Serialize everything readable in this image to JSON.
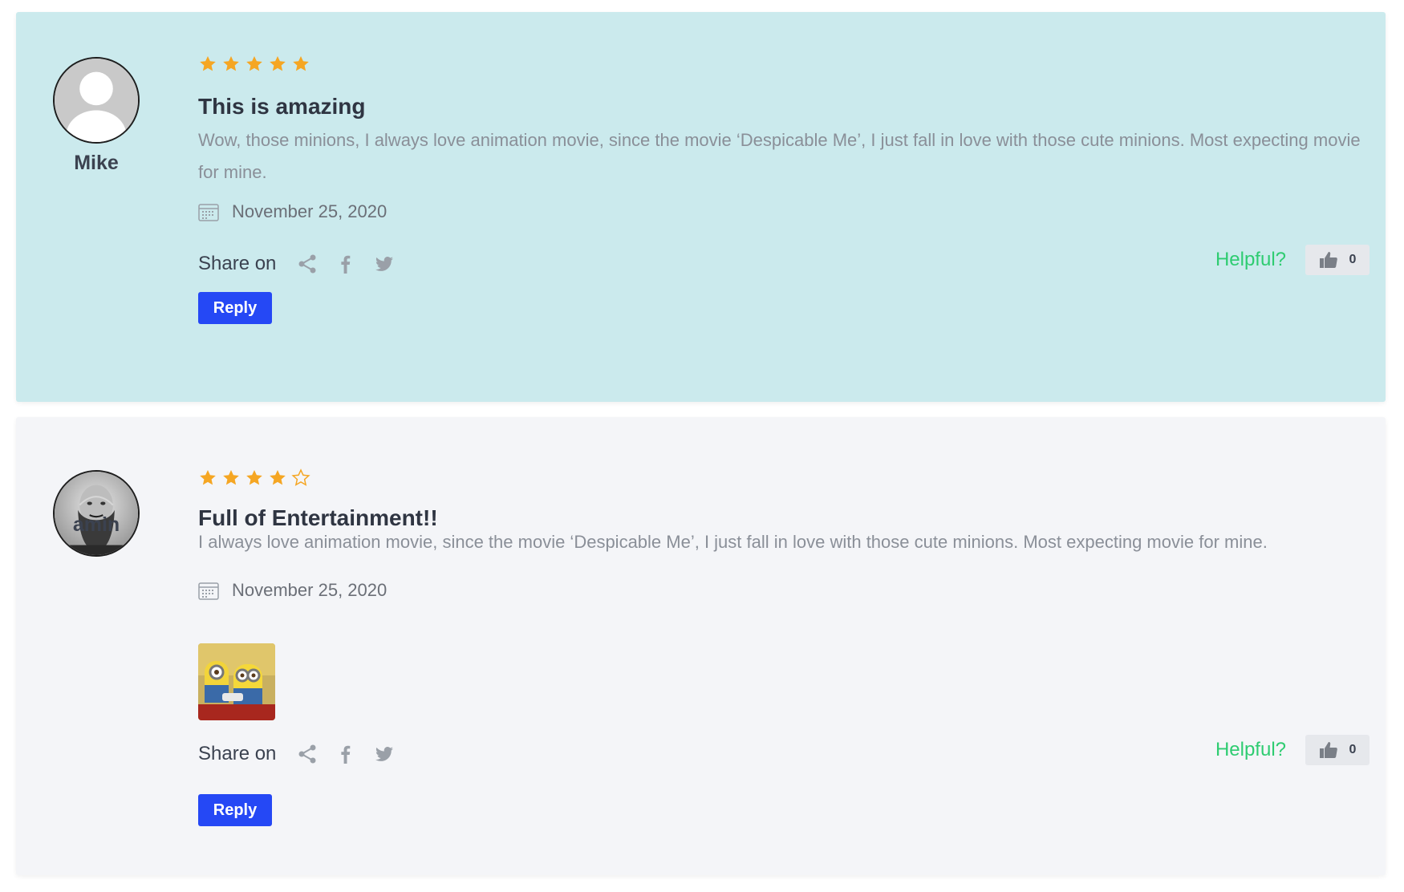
{
  "reviews": [
    {
      "author": "Mike",
      "avatar": "default-user-avatar",
      "rating": 5,
      "max_rating": 5,
      "title": "This is amazing",
      "text": "Wow, those minions, I always love animation movie, since the movie ‘Despicable Me’, I just fall in love with those cute minions. Most expecting movie for mine.",
      "date": "November 25, 2020",
      "share_label": "Share on",
      "helpful_label": "Helpful?",
      "likes": "0",
      "reply_label": "Reply",
      "background": "#cbeaed"
    },
    {
      "author": "amin",
      "avatar": "bearded-man-photo",
      "rating": 4,
      "max_rating": 5,
      "title": "Full of Entertainment!!",
      "text": "I always love animation movie, since the movie ‘Despicable Me’, I just fall in love with those cute minions. Most expecting movie for mine.",
      "date": "November 25, 2020",
      "attachment": "minions-thumbnail",
      "share_label": "Share on",
      "helpful_label": "Helpful?",
      "likes": "0",
      "reply_label": "Reply",
      "background": "#f4f5f8"
    }
  ],
  "share_icons": [
    "share-icon",
    "facebook-icon",
    "twitter-icon"
  ],
  "colors": {
    "star": "#f5a623",
    "helpful": "#2ecc71",
    "reply_button": "#2548f5",
    "icon_gray": "#9aa0a8"
  }
}
